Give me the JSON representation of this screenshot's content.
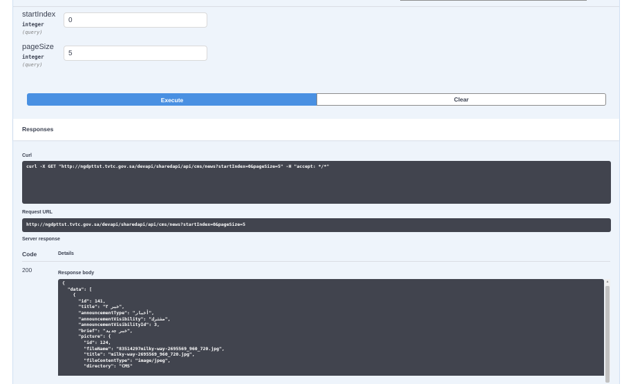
{
  "params": [
    {
      "name": "startIndex",
      "type": "integer",
      "in": "(query)",
      "value": "0"
    },
    {
      "name": "pageSize",
      "type": "integer",
      "in": "(query)",
      "value": "5"
    }
  ],
  "buttons": {
    "execute": "Execute",
    "clear": "Clear"
  },
  "responses": {
    "title": "Responses",
    "curl_label": "Curl",
    "curl": "curl -X GET \"http://ngdpttst.tvtc.gov.sa/devapi/sharedapi/api/cms/news?startIndex=0&pageSize=5\" -H \"accept: */*\"",
    "request_url_label": "Request URL",
    "request_url": "http://ngdpttst.tvtc.gov.sa/devapi/sharedapi/api/cms/news?startIndex=0&pageSize=5",
    "server_response_label": "Server response",
    "code_header": "Code",
    "details_header": "Details",
    "status_code": "200",
    "body_label": "Response body",
    "body_lines": [
      "{",
      "  \"data\": [",
      "    {",
      "      \"id\": 141,",
      "      \"title\": \"خبر ٢\",",
      "      \"announcementType\": \"أخبار\",",
      "      \"announcementVisibility\": \"مشترك\",",
      "      \"announcementVisibilityId\": 3,",
      "      \"brief\": \"خبر جديد\",",
      "      \"picture\": {",
      "        \"id\": 124,",
      "        \"fileName\": \"83514297milky-way-2695569_960_720.jpg\",",
      "        \"title\": \"milky-way-2695569_960_720.jpg\",",
      "        \"fileContentType\": \"image/jpeg\",",
      "        \"directory\": \"CMS\""
    ]
  }
}
